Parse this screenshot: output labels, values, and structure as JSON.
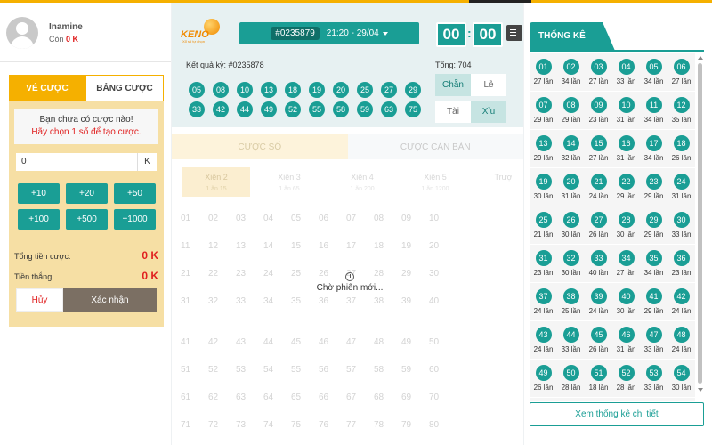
{
  "user": {
    "name": "Inamine",
    "balance_label": "Còn",
    "balance": "0 K"
  },
  "left_tabs": [
    "VÉ CƯỢC",
    "BẢNG CƯỢC"
  ],
  "notice": {
    "line1": "Bạn chưa có cược nào!",
    "line2": "Hãy chọn 1 số để tạo cược."
  },
  "amount": {
    "value": "0",
    "unit": "K"
  },
  "chips": [
    "+10",
    "+20",
    "+50",
    "+100",
    "+500",
    "+1000"
  ],
  "summary": {
    "total_label": "Tổng tiền cược:",
    "total_value": "0 K",
    "win_label": "Tiền thắng:",
    "win_value": "0 K"
  },
  "actions": {
    "cancel": "Hủy",
    "confirm": "Xác nhận"
  },
  "logo": {
    "text": "KENO",
    "sub": "Xổ số tự chọn"
  },
  "session": {
    "code": "#0235879",
    "time": "21:20 - 29/04"
  },
  "timer": {
    "minutes": "00",
    "seconds": "00"
  },
  "results": {
    "label": "Kết quả kỳ: #0235878",
    "total": "Tổng: 704",
    "balls": [
      "05",
      "08",
      "10",
      "13",
      "18",
      "19",
      "20",
      "25",
      "27",
      "29",
      "33",
      "42",
      "44",
      "49",
      "52",
      "55",
      "58",
      "59",
      "63",
      "75"
    ],
    "even_label": "Chẵn",
    "odd_label": "Lẻ",
    "big_label": "Tài",
    "small_label": "Xỉu"
  },
  "bet_tabs": [
    "CƯỢC SỐ",
    "CƯỢC CĂN BẢN"
  ],
  "modes": [
    {
      "name": "Xiên 2",
      "sub": "1 ăn 15"
    },
    {
      "name": "Xiên 3",
      "sub": "1 ăn 65"
    },
    {
      "name": "Xiên 4",
      "sub": "1 ăn 200"
    },
    {
      "name": "Xiên 5",
      "sub": "1 ăn 1200"
    },
    {
      "name": "Trượt X",
      "sub": ""
    }
  ],
  "waiting": "Chờ phiên mới...",
  "stats": {
    "title": "THỐNG KÊ",
    "items": [
      {
        "n": "01",
        "c": "27 lần"
      },
      {
        "n": "02",
        "c": "34 lần"
      },
      {
        "n": "03",
        "c": "27 lần"
      },
      {
        "n": "04",
        "c": "33 lần"
      },
      {
        "n": "05",
        "c": "34 lần"
      },
      {
        "n": "06",
        "c": "27 lần"
      },
      {
        "n": "07",
        "c": "29 lần"
      },
      {
        "n": "08",
        "c": "29 lần"
      },
      {
        "n": "09",
        "c": "23 lần"
      },
      {
        "n": "10",
        "c": "31 lần"
      },
      {
        "n": "11",
        "c": "34 lần"
      },
      {
        "n": "12",
        "c": "35 lần"
      },
      {
        "n": "13",
        "c": "29 lần"
      },
      {
        "n": "14",
        "c": "32 lần"
      },
      {
        "n": "15",
        "c": "27 lần"
      },
      {
        "n": "16",
        "c": "31 lần"
      },
      {
        "n": "17",
        "c": "34 lần"
      },
      {
        "n": "18",
        "c": "26 lần"
      },
      {
        "n": "19",
        "c": "30 lần"
      },
      {
        "n": "20",
        "c": "31 lần"
      },
      {
        "n": "21",
        "c": "24 lần"
      },
      {
        "n": "22",
        "c": "29 lần"
      },
      {
        "n": "23",
        "c": "29 lần"
      },
      {
        "n": "24",
        "c": "31 lần"
      },
      {
        "n": "25",
        "c": "21 lần"
      },
      {
        "n": "26",
        "c": "30 lần"
      },
      {
        "n": "27",
        "c": "26 lần"
      },
      {
        "n": "28",
        "c": "30 lần"
      },
      {
        "n": "29",
        "c": "29 lần"
      },
      {
        "n": "30",
        "c": "33 lần"
      },
      {
        "n": "31",
        "c": "23 lần"
      },
      {
        "n": "32",
        "c": "30 lần"
      },
      {
        "n": "33",
        "c": "40 lần"
      },
      {
        "n": "34",
        "c": "27 lần"
      },
      {
        "n": "35",
        "c": "34 lần"
      },
      {
        "n": "36",
        "c": "23 lần"
      },
      {
        "n": "37",
        "c": "24 lần"
      },
      {
        "n": "38",
        "c": "25 lần"
      },
      {
        "n": "39",
        "c": "24 lần"
      },
      {
        "n": "40",
        "c": "30 lần"
      },
      {
        "n": "41",
        "c": "29 lần"
      },
      {
        "n": "42",
        "c": "24 lần"
      },
      {
        "n": "43",
        "c": "24 lần"
      },
      {
        "n": "44",
        "c": "33 lần"
      },
      {
        "n": "45",
        "c": "26 lần"
      },
      {
        "n": "46",
        "c": "31 lần"
      },
      {
        "n": "47",
        "c": "33 lần"
      },
      {
        "n": "48",
        "c": "24 lần"
      },
      {
        "n": "49",
        "c": "26 lần"
      },
      {
        "n": "50",
        "c": "28 lần"
      },
      {
        "n": "51",
        "c": "18 lần"
      },
      {
        "n": "52",
        "c": "28 lần"
      },
      {
        "n": "53",
        "c": "33 lần"
      },
      {
        "n": "54",
        "c": "30 lần"
      }
    ],
    "detail_button": "Xem thống kê chi tiết"
  },
  "colors": {
    "accent": "#1a9e95",
    "brand": "#f5b000",
    "alert": "#e02020"
  }
}
